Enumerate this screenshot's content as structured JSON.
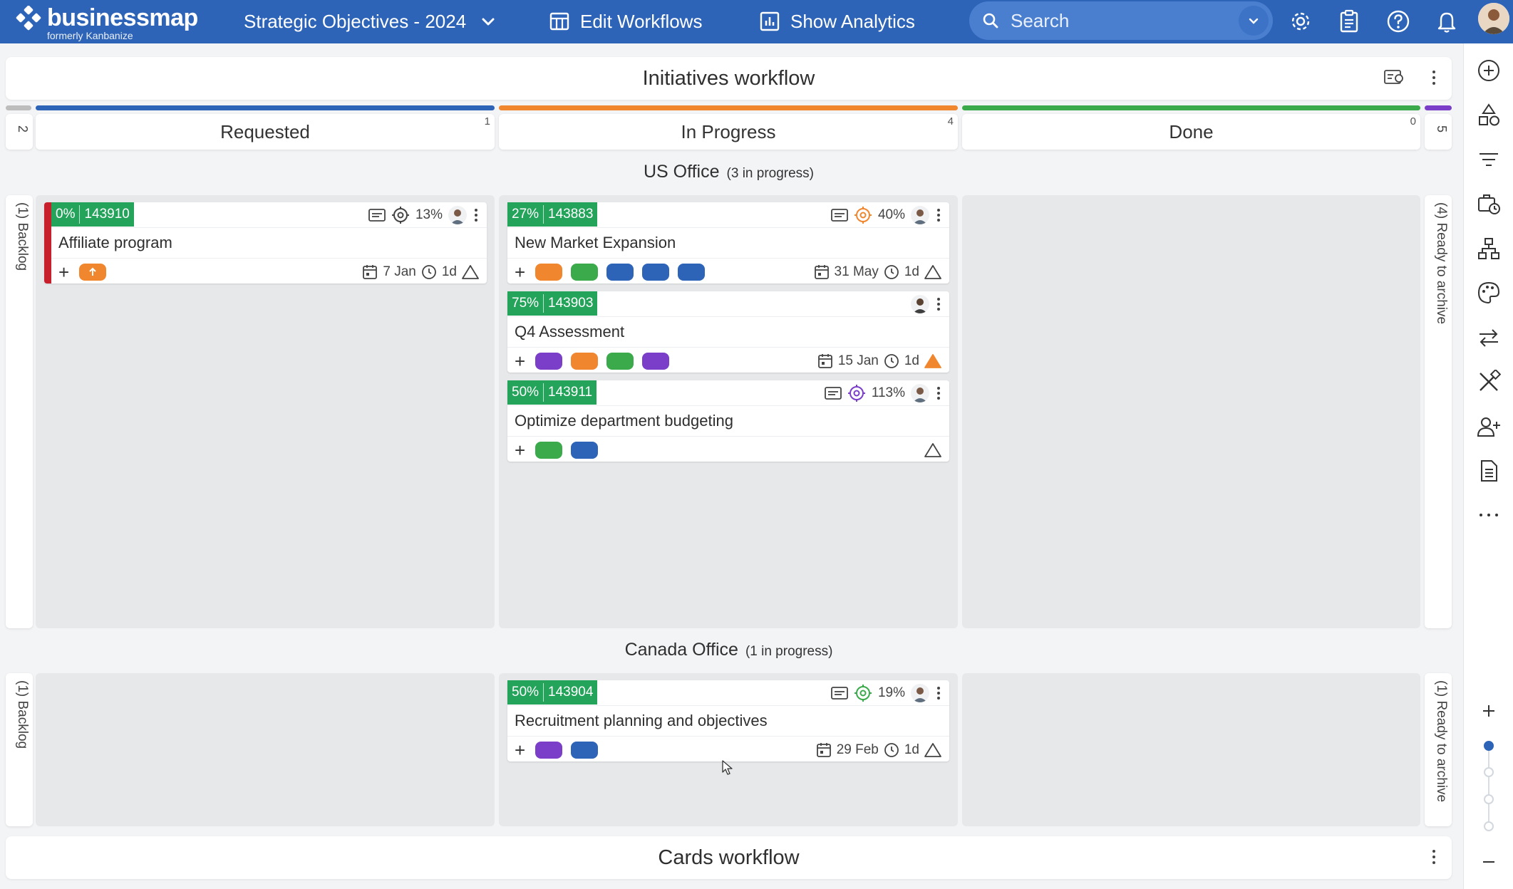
{
  "brand": {
    "name": "businessmap",
    "sub": "formerly Kanbanize"
  },
  "board_name": "Strategic Objectives - 2024",
  "nav": {
    "edit_workflows": "Edit Workflows",
    "show_analytics": "Show Analytics"
  },
  "search": {
    "placeholder": "Search"
  },
  "workflows": {
    "initiatives": "Initiatives workflow",
    "cards": "Cards workflow"
  },
  "columns": {
    "backlog_count": "2",
    "requested": {
      "label": "Requested",
      "count": "1"
    },
    "in_progress": {
      "label": "In Progress",
      "count": "4"
    },
    "done": {
      "label": "Done",
      "count": "0"
    },
    "archive_count": "5"
  },
  "lanes": {
    "us": {
      "name": "US Office",
      "sub": "(3 in progress)",
      "backlog": "(1) Backlog",
      "archive": "(4) Ready to archive"
    },
    "canada": {
      "name": "Canada Office",
      "sub": "(1 in progress)",
      "backlog": "(1) Backlog",
      "archive": "(1) Ready to archive"
    }
  },
  "cards": [
    {
      "pct": "0%",
      "id": "143910",
      "title": "Affiliate program",
      "progress": "13%",
      "date": "7 Jan",
      "age": "1d"
    },
    {
      "pct": "27%",
      "id": "143883",
      "title": "New Market Expansion",
      "progress": "40%",
      "date": "31 May",
      "age": "1d"
    },
    {
      "pct": "75%",
      "id": "143903",
      "title": "Q4 Assessment",
      "date": "15 Jan",
      "age": "1d"
    },
    {
      "pct": "50%",
      "id": "143911",
      "title": "Optimize department budgeting",
      "progress": "113%"
    },
    {
      "pct": "50%",
      "id": "143904",
      "title": "Recruitment planning and objectives",
      "progress": "19%",
      "date": "29 Feb",
      "age": "1d"
    }
  ],
  "colors": {
    "topbar": "#2d64b8",
    "requested": "#2d64b8",
    "in_progress": "#f0872f",
    "done": "#3aaa4a",
    "archive": "#7b3ec9",
    "badge": "#24a35a",
    "block_red": "#c71f2c"
  }
}
